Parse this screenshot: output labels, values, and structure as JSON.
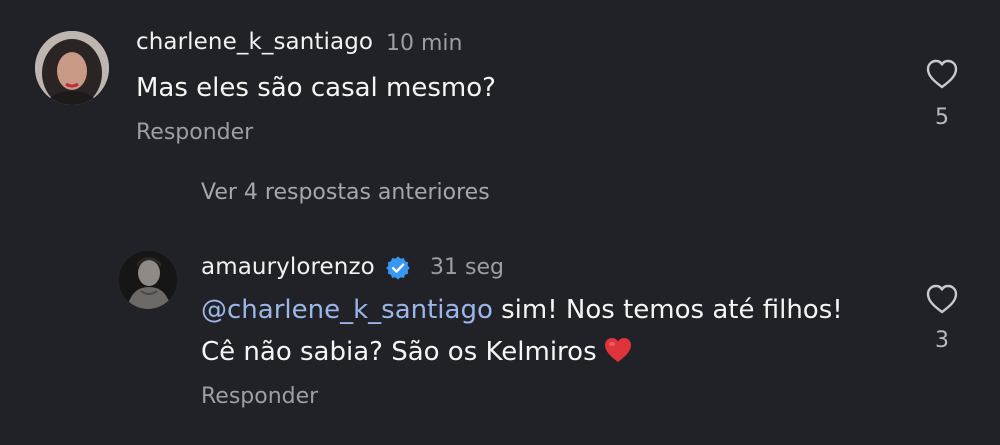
{
  "comments": [
    {
      "username": "charlene_k_santiago",
      "time": "10 min",
      "text": "Mas eles são casal mesmo?",
      "reply_label": "Responder",
      "like_count": "5",
      "avatar_icon": "user-photo-avatar"
    },
    {
      "username": "amaurylorenzo",
      "verified": true,
      "time": "31 seg",
      "mention": "@charlene_k_santiago",
      "text_line1": " sim! Nos temos até filhos!",
      "text_line2": "Cê não sabia? São os Kelmiros",
      "emoji": "red-heart-emoji",
      "reply_label": "Responder",
      "like_count": "3",
      "avatar_icon": "user-photo-avatar"
    }
  ],
  "thread": {
    "view_replies_label": "Ver 4 respostas anteriores"
  },
  "colors": {
    "background": "#212228",
    "text": "#f5f5f5",
    "muted": "#9d9ea3",
    "mention": "#9cb6e8",
    "verified": "#3897f0",
    "heart": "#e0343a"
  },
  "icons": {
    "like": "heart-outline-icon",
    "verified": "verified-badge-icon"
  }
}
